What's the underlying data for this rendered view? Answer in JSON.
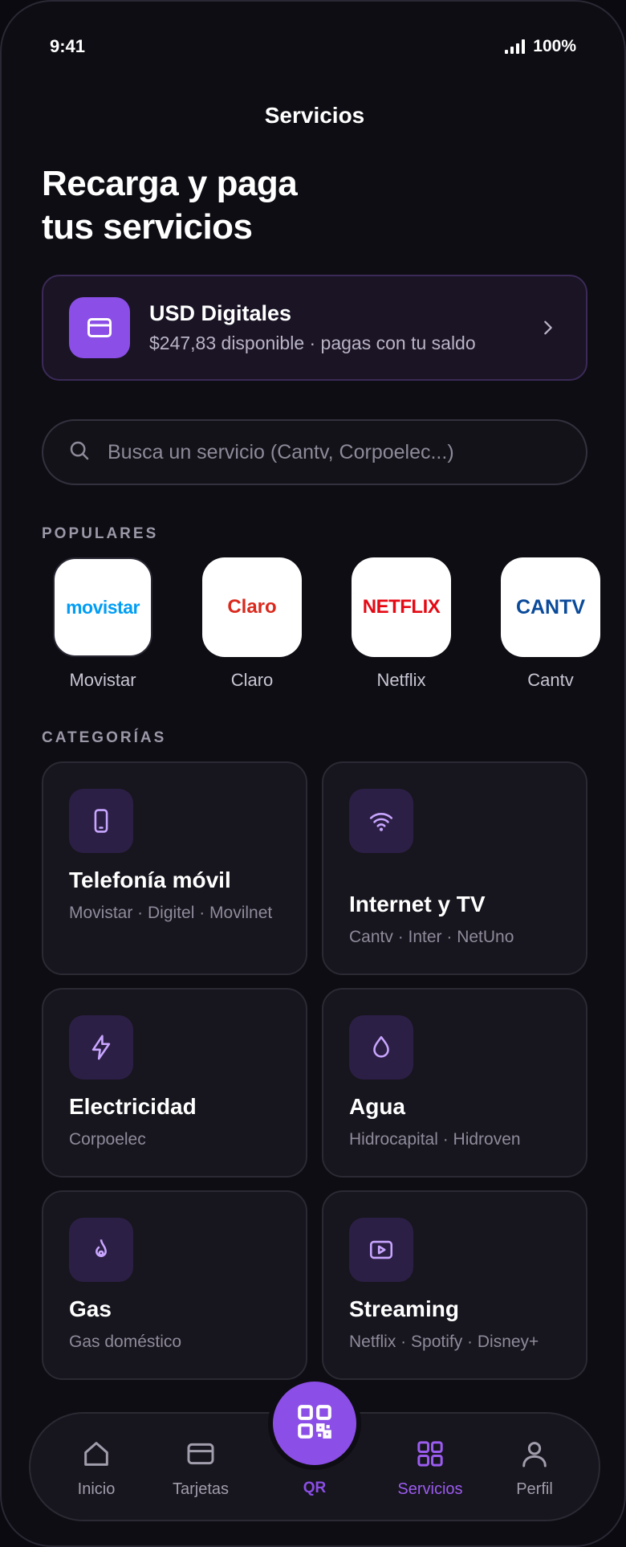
{
  "status": {
    "time": "9:41",
    "battery": "100%"
  },
  "header": {
    "title": "Servicios",
    "headline_line1": "Recarga y paga",
    "headline_line2": "tus servicios"
  },
  "wallet": {
    "icon": "card-icon",
    "title": "USD Digitales",
    "subtitle": "$247,83 disponible · pagas con tu saldo"
  },
  "search": {
    "placeholder": "Busca un servicio (Cantv, Corpoelec...)"
  },
  "popular": {
    "label": "POPULARES",
    "items": [
      {
        "name": "Movistar",
        "logo_text": "movistar",
        "logo_color": "#019df4"
      },
      {
        "name": "Claro",
        "logo_text": "Claro",
        "logo_color": "#da291c"
      },
      {
        "name": "Netflix",
        "logo_text": "NETFLIX",
        "logo_color": "#e50914"
      },
      {
        "name": "Cantv",
        "logo_text": "CANTV",
        "logo_color": "#0a4a9a"
      }
    ]
  },
  "categories": {
    "label": "CATEGORÍAS",
    "items": [
      {
        "title": "Telefonía móvil",
        "subtitle": "Movistar · Digitel · Movilnet",
        "icon": "phone-icon"
      },
      {
        "title": "Internet y TV",
        "subtitle": "Cantv · Inter · NetUno",
        "icon": "wifi-icon"
      },
      {
        "title": "Electricidad",
        "subtitle": "Corpoelec",
        "icon": "bolt-icon"
      },
      {
        "title": "Agua",
        "subtitle": "Hidrocapital · Hidroven",
        "icon": "drop-icon"
      },
      {
        "title": "Gas",
        "subtitle": "Gas doméstico",
        "icon": "flame-icon"
      },
      {
        "title": "Streaming",
        "subtitle": "Netflix · Spotify · Disney+",
        "icon": "play-icon"
      }
    ]
  },
  "tabbar": {
    "items": [
      {
        "label": "Inicio",
        "icon": "home-icon"
      },
      {
        "label": "Tarjetas",
        "icon": "card-icon"
      },
      {
        "label": "QR",
        "icon": "qr-icon"
      },
      {
        "label": "Servicios",
        "icon": "grid-icon",
        "active": true
      },
      {
        "label": "Perfil",
        "icon": "user-icon"
      }
    ]
  },
  "colors": {
    "accent": "#8b4ee6",
    "background": "#0e0d13",
    "card": "#17151d"
  }
}
